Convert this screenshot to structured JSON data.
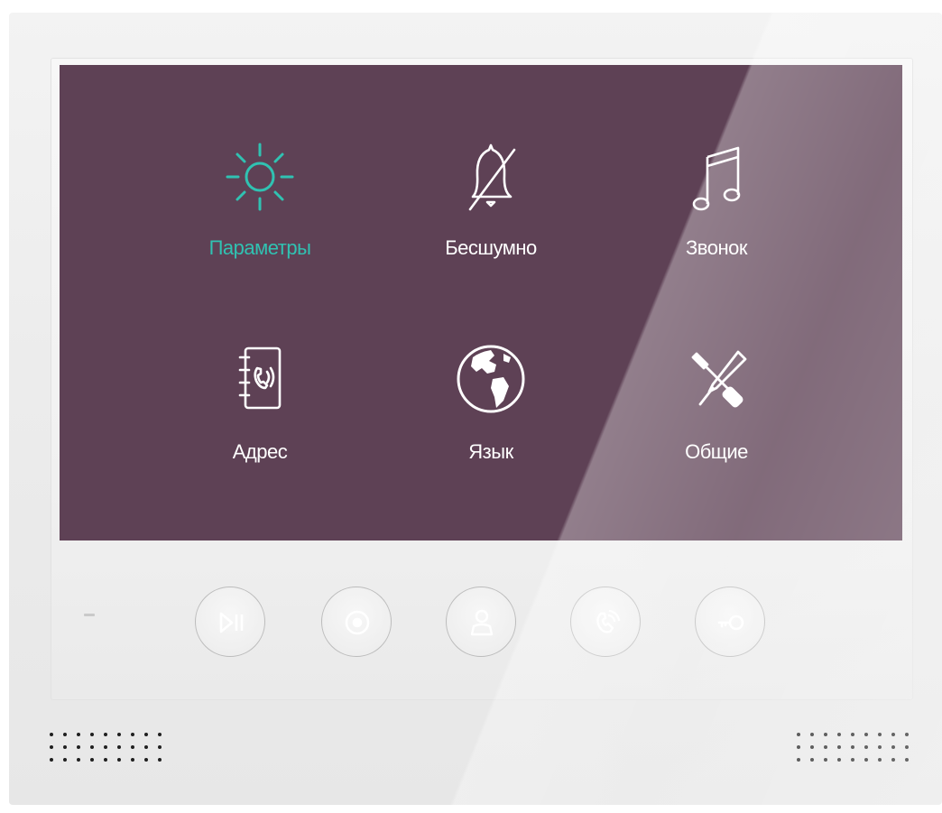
{
  "screen": {
    "background_color": "#5e4155",
    "accent_color": "#30c2b2",
    "menu": {
      "items": [
        {
          "label": "Параметры",
          "icon": "brightness-icon",
          "active": true
        },
        {
          "label": "Бесшумно",
          "icon": "bell-mute-icon",
          "active": false
        },
        {
          "label": "Звонок",
          "icon": "music-note-icon",
          "active": false
        },
        {
          "label": "Адрес",
          "icon": "address-book-icon",
          "active": false
        },
        {
          "label": "Язык",
          "icon": "globe-icon",
          "active": false
        },
        {
          "label": "Общие",
          "icon": "tools-icon",
          "active": false
        }
      ]
    }
  },
  "panel": {
    "buttons": [
      {
        "icon": "play-pause-icon"
      },
      {
        "icon": "record-icon"
      },
      {
        "icon": "user-icon"
      },
      {
        "icon": "phone-icon"
      },
      {
        "icon": "key-icon"
      }
    ]
  }
}
